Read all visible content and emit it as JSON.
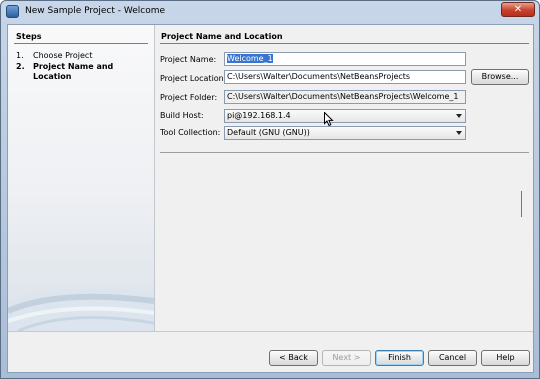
{
  "window": {
    "title": "New Sample Project - Welcome",
    "close_glyph": "✕"
  },
  "steps": {
    "title": "Steps",
    "items": [
      {
        "num": "1.",
        "label": "Choose Project",
        "active": false
      },
      {
        "num": "2.",
        "label": "Project Name and Location",
        "active": true
      }
    ]
  },
  "panel": {
    "title": "Project Name and Location",
    "fields": {
      "project_name": {
        "label": "Project Name:",
        "value": "Welcome_1"
      },
      "project_location": {
        "label": "Project Location:",
        "value": "C:\\Users\\Walter\\Documents\\NetBeansProjects"
      },
      "project_folder": {
        "label": "Project Folder:",
        "value": "C:\\Users\\Walter\\Documents\\NetBeansProjects\\Welcome_1"
      },
      "build_host": {
        "label": "Build Host:",
        "value": "pi@192.168.1.4"
      },
      "tool_collection": {
        "label": "Tool Collection:",
        "value": "Default (GNU (GNU))"
      }
    },
    "browse_label": "Browse..."
  },
  "buttons": {
    "back": "< Back",
    "next": "Next >",
    "finish": "Finish",
    "cancel": "Cancel",
    "help": "Help"
  },
  "icons": {
    "app": "netbeans-app-icon",
    "close": "close-icon",
    "dropdown": "chevron-down-icon",
    "cursor": "mouse-pointer-icon"
  }
}
